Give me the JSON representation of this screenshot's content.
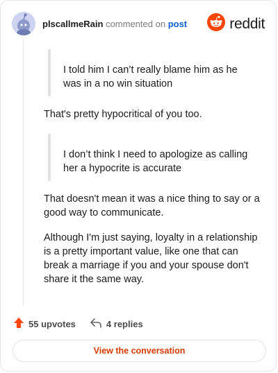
{
  "header": {
    "username": "plscallmeRain",
    "action_text": "commented on",
    "post_link": "post",
    "brand_word": "reddit"
  },
  "comment": {
    "quote_1": "I told him I can’t really blame him as he was in a no win situation",
    "para_1": "That's pretty hypocritical of you too.",
    "quote_2": "I don’t think I need to apologize as calling her a hypocrite is accurate",
    "para_2": "That doesn't mean it was a nice thing to say or a good way to communicate.",
    "para_3": "Although I'm just saying, loyalty in a relationship is a pretty important value, like one that can break a marriage if you and your spouse don't share it the same way."
  },
  "footer": {
    "upvotes": "55 upvotes",
    "replies": "4 replies"
  },
  "cta": {
    "label": "View the conversation"
  },
  "colors": {
    "brand_orange": "#ff4500",
    "link_blue": "#0b5ecf",
    "cta_text": "#d93a00"
  },
  "icons": {
    "avatar": "snoo-avatar-icon",
    "logo": "reddit-logo-icon",
    "upvote": "upvote-arrow-icon",
    "reply": "reply-arrow-icon"
  }
}
